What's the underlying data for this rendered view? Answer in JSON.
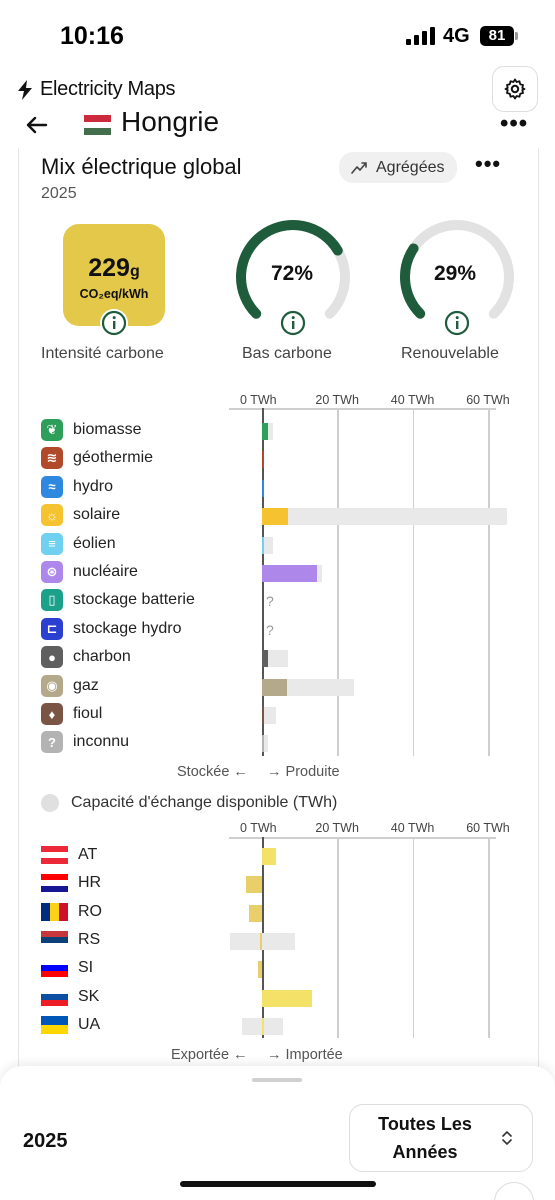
{
  "status_bar": {
    "time": "10:16",
    "network": "4G",
    "battery": "81"
  },
  "app": {
    "brand": "Electricity Maps",
    "country": "Hongrie"
  },
  "card": {
    "title": "Mix électrique global",
    "year": "2025",
    "aggregate_label": "Agrégées"
  },
  "kpis": {
    "intensity_value": "229",
    "intensity_unit_g": "g",
    "intensity_unit": "CO₂eq/kWh",
    "intensity_label": "Intensité carbone",
    "low_carbon_percent": 72,
    "low_carbon_text": "72%",
    "low_carbon_label": "Bas carbone",
    "renewable_percent": 29,
    "renewable_text": "29%",
    "renewable_label": "Renouvelable"
  },
  "production_chart": {
    "ticks": [
      "0 TWh",
      "20 TWh",
      "40 TWh",
      "60 TWh"
    ],
    "tick_values": [
      0,
      20,
      40,
      60
    ],
    "sources": [
      {
        "label": "biomasse",
        "icon": "sprout-icon",
        "color": "#2e9e5b",
        "value": 1.6,
        "capacity": 3.0
      },
      {
        "label": "géothermie",
        "icon": "heat-icon",
        "color": "#b04a2a",
        "value": 0.1,
        "capacity": 0.1
      },
      {
        "label": "hydro",
        "icon": "wave-icon",
        "color": "#2f88e0",
        "value": 0.2,
        "capacity": 0.5
      },
      {
        "label": "solaire",
        "icon": "sun-icon",
        "color": "#f5c230",
        "value": 6.8,
        "capacity": 65.0
      },
      {
        "label": "éolien",
        "icon": "wind-icon",
        "color": "#6fd0ef",
        "value": 0.6,
        "capacity": 2.8
      },
      {
        "label": "nucléaire",
        "icon": "atom-icon",
        "color": "#ad87ea",
        "value": 14.5,
        "capacity": 15.8
      },
      {
        "label": "stockage batterie",
        "icon": "battery-icon",
        "color": "#1ba08a",
        "value": null,
        "capacity": null
      },
      {
        "label": "stockage hydro",
        "icon": "hydro-storage-icon",
        "color": "#2b3fd0",
        "value": null,
        "capacity": null
      },
      {
        "label": "charbon",
        "icon": "coal-icon",
        "color": "#5f5f5f",
        "value": 1.5,
        "capacity": 6.9
      },
      {
        "label": "gaz",
        "icon": "gas-icon",
        "color": "#b5a98c",
        "value": 6.7,
        "capacity": 24.5
      },
      {
        "label": "fioul",
        "icon": "oil-icon",
        "color": "#7a5445",
        "value": 0.2,
        "capacity": 3.7
      },
      {
        "label": "inconnu",
        "icon": "question-icon",
        "color": "#b3b3b3",
        "value": 0.3,
        "capacity": 1.5
      }
    ],
    "footer_left": "Stockée ←",
    "footer_right": "→ Produite"
  },
  "exchange_chart": {
    "title": "Capacité d'échange disponible (TWh)",
    "ticks": [
      "0 TWh",
      "20 TWh",
      "40 TWh",
      "60 TWh"
    ],
    "zones": [
      {
        "code": "AT",
        "flag": "flag-at",
        "value": 3.7,
        "cap_min": 0,
        "cap_max": 3.7
      },
      {
        "code": "HR",
        "flag": "flag-hr",
        "value": -4.3,
        "cap_min": -4.3,
        "cap_max": 0
      },
      {
        "code": "RO",
        "flag": "flag-ro",
        "value": -3.5,
        "cap_min": -3.5,
        "cap_max": 0
      },
      {
        "code": "RS",
        "flag": "flag-rs",
        "value": -0.5,
        "cap_min": -8.5,
        "cap_max": 8.8
      },
      {
        "code": "SI",
        "flag": "flag-si",
        "value": -1.0,
        "cap_min": -1.0,
        "cap_max": 0
      },
      {
        "code": "SK",
        "flag": "flag-sk",
        "value": 13.3,
        "cap_min": 0,
        "cap_max": 13.3
      },
      {
        "code": "UA",
        "flag": "flag-ua",
        "value": 0.3,
        "cap_min": -5.3,
        "cap_max": 5.5
      }
    ],
    "footer_left": "Exportée ←",
    "footer_right": "→ Importée"
  },
  "bottom_sheet": {
    "year": "2025",
    "range_line1": "Toutes Les",
    "range_line2": "Années"
  }
}
